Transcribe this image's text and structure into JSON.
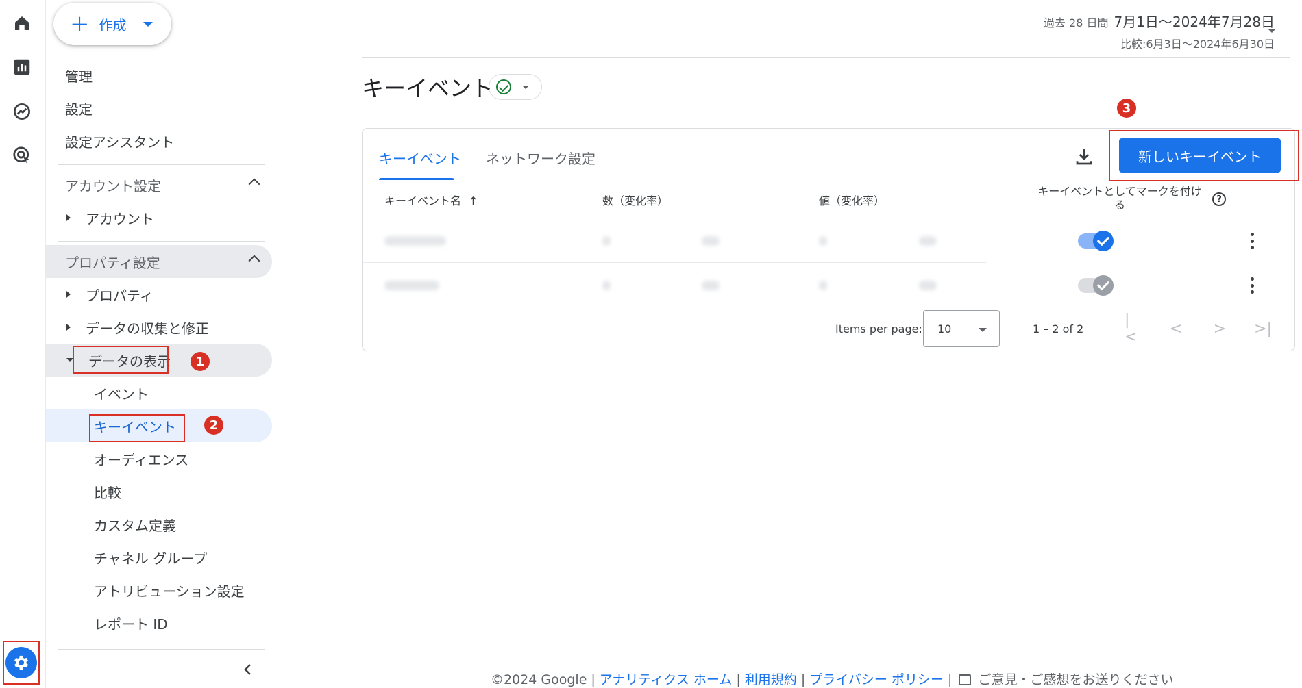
{
  "create": {
    "label": "作成"
  },
  "nav": {
    "admin": "管理",
    "settings": "設定",
    "setup_assistant": "設定アシスタント",
    "account_settings": "アカウント設定",
    "account": "アカウント",
    "property_settings": "プロパティ設定",
    "property": "プロパティ",
    "data_collection": "データの収集と修正",
    "data_display": "データの表示",
    "events": "イベント",
    "key_events": "キーイベント",
    "audiences": "オーディエンス",
    "comparisons": "比較",
    "custom_definitions": "カスタム定義",
    "channel_groups": "チャネル グループ",
    "attribution_settings": "アトリビューション設定",
    "report_id": "レポート ID"
  },
  "annotations": {
    "badge1": "1",
    "badge2": "2",
    "badge3": "3"
  },
  "date": {
    "period_label": "過去 28 日間",
    "range": "7月1日～2024年7月28日",
    "compare": "比較:6月3日～2024年6月30日"
  },
  "page": {
    "title": "キーイベント"
  },
  "tabs": {
    "key_events": "キーイベント",
    "network_settings": "ネットワーク設定"
  },
  "new_button": "新しいキーイベント",
  "table": {
    "headers": {
      "name": "キーイベント名",
      "count": "数（変化率）",
      "value": "値（変化率）",
      "mark_line1": "キーイベントとしてマークを付け",
      "mark_line2": "る"
    },
    "rows": [
      {
        "toggle": "on-blue"
      },
      {
        "toggle": "on-grey"
      }
    ]
  },
  "pagination": {
    "items_per_page_label": "Items per page:",
    "items_per_page": "10",
    "range": "1 – 2 of 2"
  },
  "footer": {
    "copyright": "©2024 Google |",
    "home": "アナリティクス ホーム",
    "sep1": "|",
    "terms": "利用規約",
    "sep2": "|",
    "privacy": "プライバシー ポリシー",
    "sep3": "|",
    "feedback": "ご意見・ご感想をお送りください"
  },
  "colors": {
    "accent": "#1a73e8",
    "annotation": "#d93025"
  }
}
